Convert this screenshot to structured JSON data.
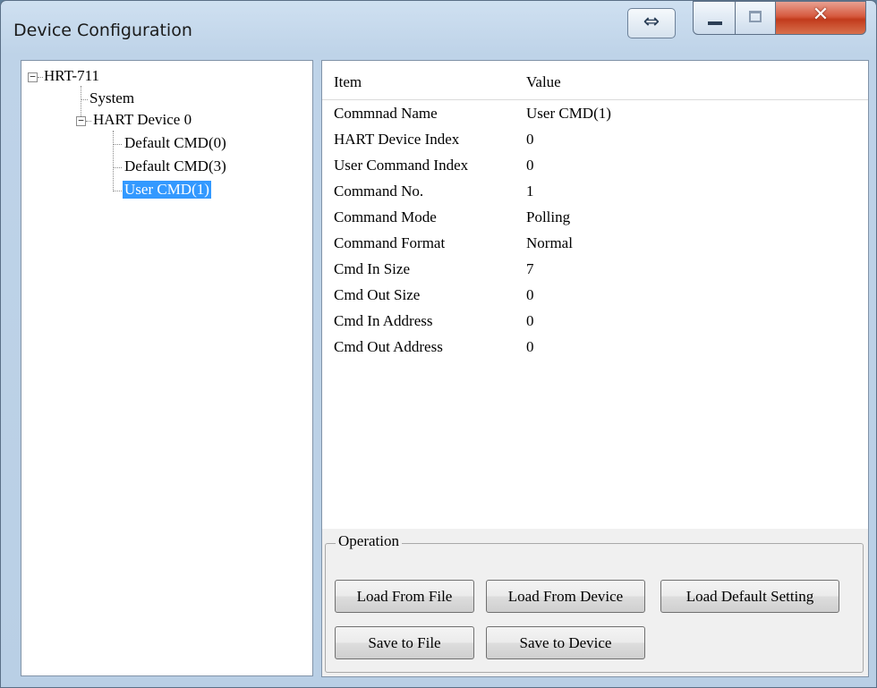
{
  "window": {
    "title": "Device Configuration"
  },
  "titlebar": {
    "swap_glyph": "⇔",
    "icons": [
      "swap-icon",
      "minimize-icon",
      "maximize-icon",
      "close-icon"
    ],
    "close_glyph": "✕"
  },
  "tree": {
    "root": "HRT-711",
    "system": "System",
    "device": "HART Device 0",
    "cmd0": "Default CMD(0)",
    "cmd3": "Default CMD(3)",
    "user_cmd": "User CMD(1)",
    "selected": "User CMD(1)"
  },
  "list": {
    "columns": [
      "Item",
      "Value"
    ],
    "rows": [
      {
        "item": "Commnad Name",
        "value": "User CMD(1)"
      },
      {
        "item": "HART Device Index",
        "value": "0"
      },
      {
        "item": "User Command Index",
        "value": "0"
      },
      {
        "item": "Command No.",
        "value": "1"
      },
      {
        "item": "Command Mode",
        "value": "Polling"
      },
      {
        "item": "Command Format",
        "value": "Normal"
      },
      {
        "item": "Cmd In Size",
        "value": "7"
      },
      {
        "item": "Cmd Out Size",
        "value": "0"
      },
      {
        "item": "Cmd In Address",
        "value": "0"
      },
      {
        "item": "Cmd Out Address",
        "value": "0"
      }
    ]
  },
  "operation": {
    "label": "Operation",
    "load_from_file": "Load From File",
    "load_from_device": "Load From Device",
    "load_default": "Load Default Setting",
    "save_to_file": "Save to File",
    "save_to_device": "Save to Device"
  }
}
